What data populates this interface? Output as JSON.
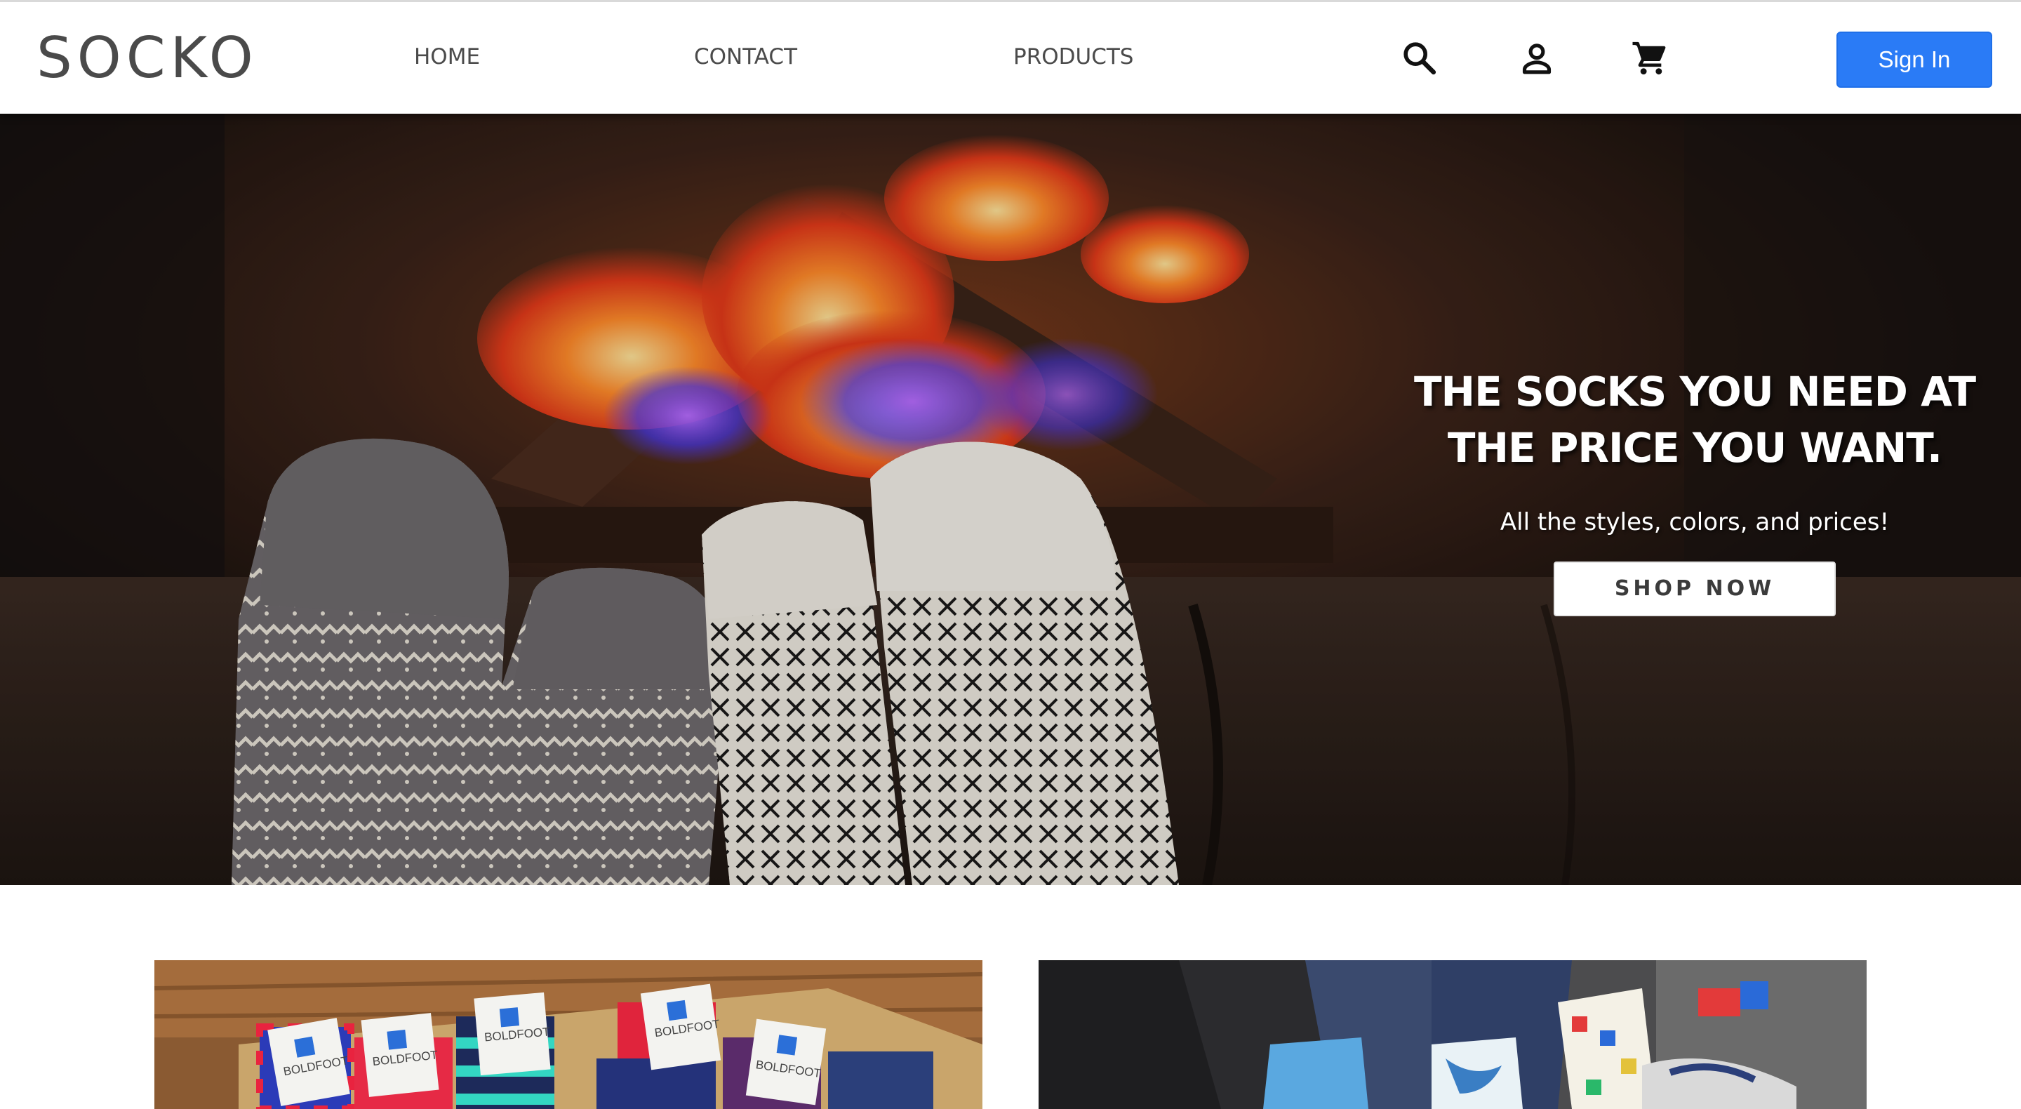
{
  "header": {
    "logo": "SOCKO",
    "nav": [
      {
        "label": "HOME"
      },
      {
        "label": "CONTACT"
      },
      {
        "label": "PRODUCTS"
      }
    ],
    "icons": [
      "search-icon",
      "account-icon",
      "cart-icon"
    ],
    "sign_in_label": "Sign In"
  },
  "hero": {
    "title_line1": "THE SOCKS YOU NEED AT",
    "title_line2": "THE PRICE YOU WANT.",
    "subtitle": "All the styles, colors, and prices!",
    "cta_label": "SHOP NOW"
  },
  "tiles": {
    "box_brand": "BOLDFOOT"
  },
  "colors": {
    "accent": "#2a7bf6",
    "nav_text": "#4b4b4b",
    "logo_text": "#4a4a4a"
  }
}
